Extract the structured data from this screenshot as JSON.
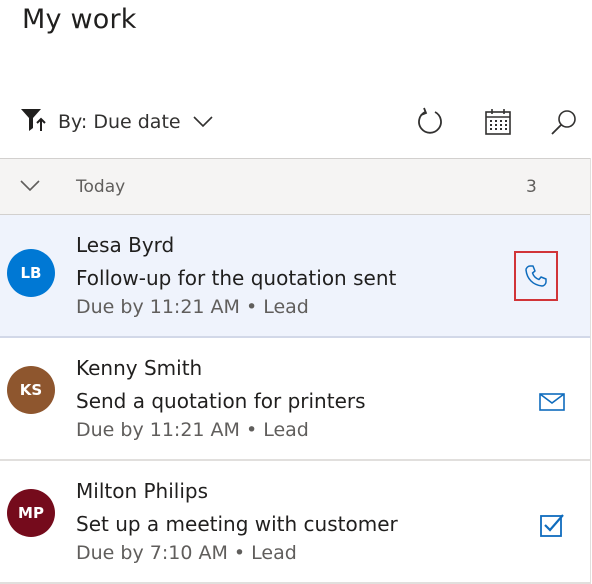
{
  "header": {
    "title": "My work"
  },
  "toolbar": {
    "filter_label": "By: Due date",
    "icons": {
      "filter": "filter-icon",
      "refresh": "refresh-icon",
      "calendar": "calendar-icon",
      "search": "search-icon"
    }
  },
  "group": {
    "label": "Today",
    "count": "3"
  },
  "items": [
    {
      "initials": "LB",
      "avatar_color": "#0078d4",
      "name": "Lesa Byrd",
      "subject": "Follow-up for the quotation sent",
      "due": "Due by 11:21 AM • Lead",
      "action_icon": "phone-icon",
      "selected": true
    },
    {
      "initials": "KS",
      "avatar_color": "#8e562e",
      "name": "Kenny Smith",
      "subject": "Send a quotation for printers",
      "due": "Due by 11:21 AM • Lead",
      "action_icon": "email-icon",
      "selected": false
    },
    {
      "initials": "MP",
      "avatar_color": "#750b1c",
      "name": "Milton Philips",
      "subject": "Set up a meeting with customer",
      "due": "Due by 7:10 AM • Lead",
      "action_icon": "task-icon",
      "selected": false
    }
  ],
  "colors": {
    "accent": "#0f6cbd",
    "selected_bg": "#eff3fc",
    "highlight_box": "#d13438"
  }
}
